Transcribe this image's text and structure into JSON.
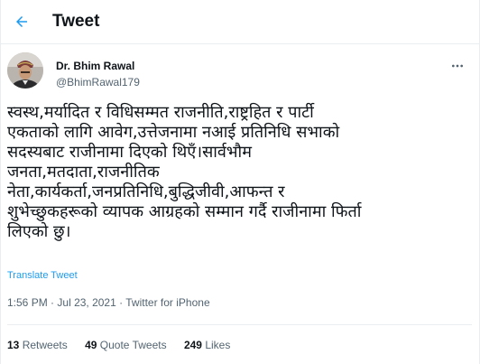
{
  "header": {
    "back_icon": "arrow-left-icon",
    "title": "Tweet",
    "accent_color": "#1d9bf0"
  },
  "tweet": {
    "author": {
      "name": "Dr. Bhim Rawal",
      "handle": "@BhimRawal179",
      "avatar": "avatar-photo"
    },
    "more_icon": "more-horizontal-icon",
    "text": "स्वस्थ,मर्यादित र विधिसम्मत राजनीति,राष्ट्रहित र पार्टी\nएकताको लागि आवेग,उत्तेजनामा नआई प्रतिनिधि सभाको\nसदस्यबाट राजीनामा दिएको थिएँ।सार्वभौम\nजनता,मतदाता,राजनीतिक\nनेता,कार्यकर्ता,जनप्रतिनिधि,बुद्धिजीवी,आफन्त र\nशुभेच्छुकहरूको व्यापक आग्रहको सम्मान गर्दै राजीनामा  फिर्ता\nलिएको छु।",
    "translate_label": "Translate Tweet",
    "time": "1:56 PM",
    "date": "Jul 23, 2021",
    "separator": "·",
    "source": "Twitter for iPhone"
  },
  "stats": {
    "retweets_count": "13",
    "retweets_label": "Retweets",
    "quotes_count": "49",
    "quotes_label": "Quote Tweets",
    "likes_count": "249",
    "likes_label": "Likes"
  }
}
